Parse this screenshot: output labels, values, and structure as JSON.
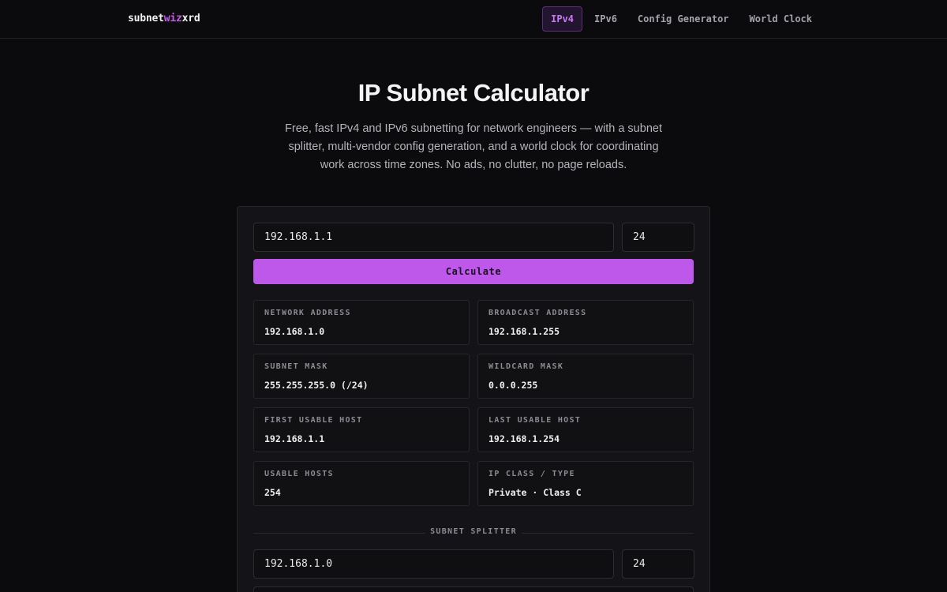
{
  "brand": {
    "part1": "subnet",
    "accent": "wiz",
    "part2": "xrd",
    "accent_color": "#c25be8"
  },
  "nav": {
    "items": [
      {
        "label": "IPv4",
        "active": true
      },
      {
        "label": "IPv6",
        "active": false
      },
      {
        "label": "Config Generator",
        "active": false
      },
      {
        "label": "World Clock",
        "active": false
      }
    ]
  },
  "hero": {
    "title": "IP Subnet Calculator",
    "subtitle": "Free, fast IPv4 and IPv6 subnetting for network engineers — with a subnet splitter, multi-vendor config generation, and a world clock for coordinating work across time zones. No ads, no clutter, no page reloads."
  },
  "calculator": {
    "ip_value": "192.168.1.1",
    "prefix_value": "24",
    "calculate_label": "Calculate",
    "button_color": "#bd58ea",
    "results": [
      {
        "label": "NETWORK ADDRESS",
        "value": "192.168.1.0"
      },
      {
        "label": "BROADCAST ADDRESS",
        "value": "192.168.1.255"
      },
      {
        "label": "SUBNET MASK",
        "value": "255.255.255.0 (/24)"
      },
      {
        "label": "WILDCARD MASK",
        "value": "0.0.0.255"
      },
      {
        "label": "FIRST USABLE HOST",
        "value": "192.168.1.1"
      },
      {
        "label": "LAST USABLE HOST",
        "value": "192.168.1.254"
      },
      {
        "label": "USABLE HOSTS",
        "value": "254"
      },
      {
        "label": "IP CLASS / TYPE",
        "value": "Private · Class C"
      }
    ]
  },
  "splitter": {
    "heading": "SUBNET SPLITTER",
    "network_value": "192.168.1.0",
    "prefix_value": "24"
  }
}
